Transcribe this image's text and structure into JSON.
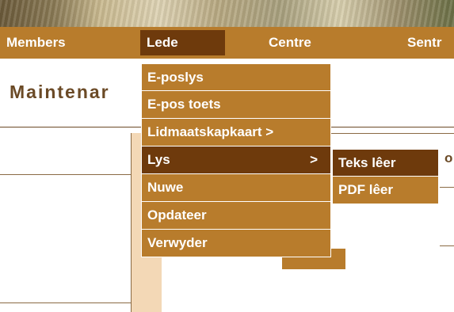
{
  "nav": {
    "items": [
      "Members",
      "Lede",
      "Centre",
      "Sentr"
    ]
  },
  "page": {
    "title": "Maintenar",
    "peek_char": "o"
  },
  "menu": {
    "items": [
      {
        "label": "E-poslys"
      },
      {
        "label": "E-pos toets"
      },
      {
        "label": "Lidmaatskapkaart >"
      },
      {
        "label": "Lys",
        "arrow": ">"
      },
      {
        "label": "Nuwe"
      },
      {
        "label": "Opdateer"
      },
      {
        "label": "Verwyder"
      }
    ],
    "submenu": [
      "Teks lêer",
      "PDF lêer"
    ]
  },
  "colors": {
    "nav_bg": "#b87c2c",
    "active_bg": "#6e3a0c",
    "title": "#6b4a26"
  }
}
